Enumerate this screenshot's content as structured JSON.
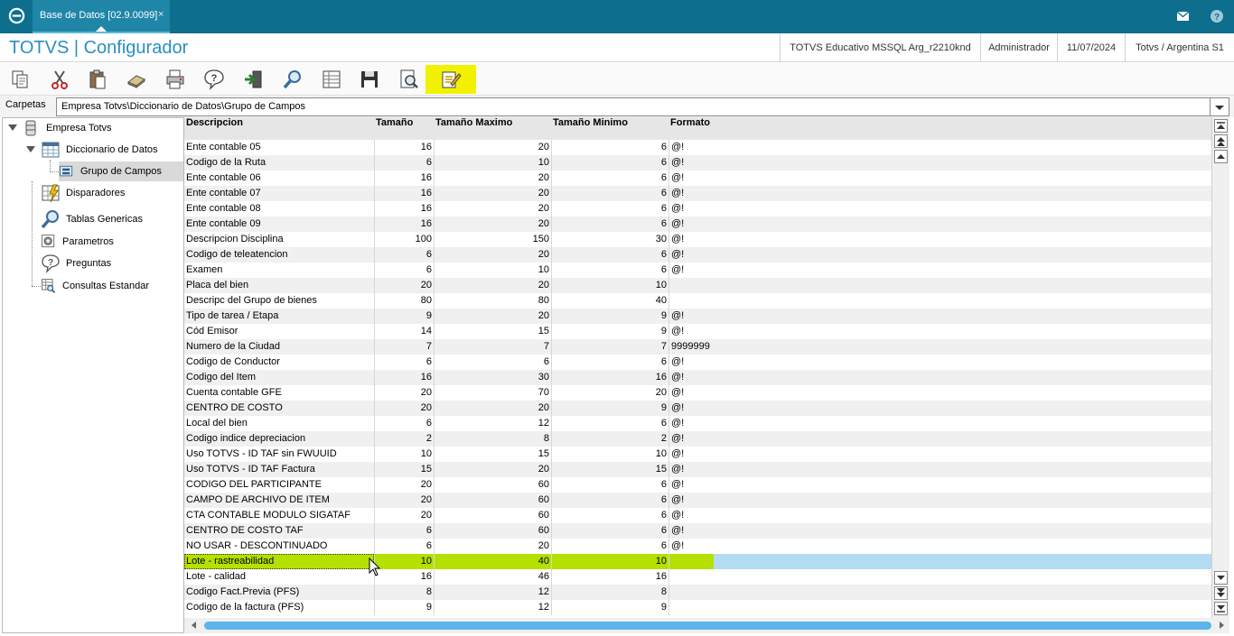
{
  "window": {
    "tab_title": "Base de Datos [02.9.0099]",
    "tab_close": "×",
    "app_title": "TOTVS | Configurador"
  },
  "status": {
    "environment": "TOTVS Educativo MSSQL Arg_r2210knd",
    "user": "Administrador",
    "date": "11/07/2024",
    "company": "Totvs / Argentina S1"
  },
  "toolbar": {
    "buttons": [
      {
        "icon": "copy-icon"
      },
      {
        "icon": "cut-icon"
      },
      {
        "icon": "paste-icon"
      },
      {
        "icon": "eraser-icon"
      },
      {
        "icon": "printer-icon"
      },
      {
        "icon": "help-icon"
      },
      {
        "icon": "exit-icon"
      },
      {
        "icon": "search-icon"
      },
      {
        "icon": "table-icon"
      },
      {
        "icon": "save-icon"
      },
      {
        "icon": "preview-icon"
      },
      {
        "icon": "edit-icon",
        "active": true
      }
    ]
  },
  "folders": {
    "label": "Carpetas",
    "path": "Empresa Totvs\\Diccionario de Datos\\Grupo de Campos"
  },
  "tree": {
    "root": "Empresa Totvs",
    "dictionary": "Diccionario de Datos",
    "field_groups": "Grupo de Campos",
    "triggers": "Disparadores",
    "generic_tables": "Tablas Genericas",
    "parameters": "Parametros",
    "questions": "Preguntas",
    "standard_queries": "Consultas Estandar"
  },
  "grid": {
    "columns": {
      "descripcion": "Descripcion",
      "tamano": "Tamaño",
      "tamano_maximo": "Tamaño Maximo",
      "tamano_minimo": "Tamaño Minimo",
      "formato": "Formato"
    },
    "rows": [
      {
        "d": "Ente contable 05",
        "t": "16",
        "max": "20",
        "min": "6",
        "f": "@!"
      },
      {
        "d": "Codigo de la Ruta",
        "t": "6",
        "max": "10",
        "min": "6",
        "f": "@!"
      },
      {
        "d": "Ente contable 06",
        "t": "16",
        "max": "20",
        "min": "6",
        "f": "@!"
      },
      {
        "d": "Ente contable 07",
        "t": "16",
        "max": "20",
        "min": "6",
        "f": "@!"
      },
      {
        "d": "Ente contable 08",
        "t": "16",
        "max": "20",
        "min": "6",
        "f": "@!"
      },
      {
        "d": "Ente contable 09",
        "t": "16",
        "max": "20",
        "min": "6",
        "f": "@!"
      },
      {
        "d": "Descripcion Disciplina",
        "t": "100",
        "max": "150",
        "min": "30",
        "f": "@!"
      },
      {
        "d": "Codigo de teleatencion",
        "t": "6",
        "max": "20",
        "min": "6",
        "f": "@!"
      },
      {
        "d": "Examen",
        "t": "6",
        "max": "10",
        "min": "6",
        "f": "@!"
      },
      {
        "d": "Placa del bien",
        "t": "20",
        "max": "20",
        "min": "10",
        "f": ""
      },
      {
        "d": "Descripc del Grupo de bienes",
        "t": "80",
        "max": "80",
        "min": "40",
        "f": ""
      },
      {
        "d": "Tipo de tarea / Etapa",
        "t": "9",
        "max": "20",
        "min": "9",
        "f": "@!"
      },
      {
        "d": "Cód Emisor",
        "t": "14",
        "max": "15",
        "min": "9",
        "f": "@!"
      },
      {
        "d": "Numero de la Ciudad",
        "t": "7",
        "max": "7",
        "min": "7",
        "f": "9999999"
      },
      {
        "d": "Codigo de Conductor",
        "t": "6",
        "max": "6",
        "min": "6",
        "f": "@!"
      },
      {
        "d": "Codigo del Item",
        "t": "16",
        "max": "30",
        "min": "16",
        "f": "@!"
      },
      {
        "d": "Cuenta contable GFE",
        "t": "20",
        "max": "70",
        "min": "20",
        "f": "@!"
      },
      {
        "d": "CENTRO DE COSTO",
        "t": "20",
        "max": "20",
        "min": "9",
        "f": "@!"
      },
      {
        "d": "Local del bien",
        "t": "6",
        "max": "12",
        "min": "6",
        "f": "@!"
      },
      {
        "d": "Codigo indice depreciacion",
        "t": "2",
        "max": "8",
        "min": "2",
        "f": "@!"
      },
      {
        "d": "Uso TOTVS - ID TAF sin FWUUID",
        "t": "10",
        "max": "15",
        "min": "10",
        "f": "@!"
      },
      {
        "d": "Uso TOTVS - ID TAF Factura",
        "t": "15",
        "max": "20",
        "min": "15",
        "f": "@!"
      },
      {
        "d": "CODIGO DEL PARTICIPANTE",
        "t": "20",
        "max": "60",
        "min": "6",
        "f": "@!"
      },
      {
        "d": "CAMPO DE ARCHIVO DE ITEM",
        "t": "20",
        "max": "60",
        "min": "6",
        "f": "@!"
      },
      {
        "d": "CTA CONTABLE MODULO SIGATAF",
        "t": "20",
        "max": "60",
        "min": "6",
        "f": "@!"
      },
      {
        "d": "CENTRO DE COSTO TAF",
        "t": "6",
        "max": "60",
        "min": "6",
        "f": "@!"
      },
      {
        "d": "NO USAR - DESCONTINUADO",
        "t": "6",
        "max": "20",
        "min": "6",
        "f": "@!"
      },
      {
        "d": "Lote - rastreabilidad",
        "t": "10",
        "max": "40",
        "min": "10",
        "f": "",
        "selected": true
      },
      {
        "d": "Lote - calidad",
        "t": "16",
        "max": "46",
        "min": "16",
        "f": ""
      },
      {
        "d": "Codigo Fact.Previa (PFS)",
        "t": "8",
        "max": "12",
        "min": "8",
        "f": ""
      },
      {
        "d": "Codigo de la factura (PFS)",
        "t": "9",
        "max": "12",
        "min": "9",
        "f": ""
      }
    ]
  },
  "colors": {
    "topbar": "#0d6e8e",
    "title": "#2a8fc1",
    "selected_row": "#b3dcf3",
    "selected_cells": "#b5e000",
    "active_tool": "#f2f200"
  }
}
